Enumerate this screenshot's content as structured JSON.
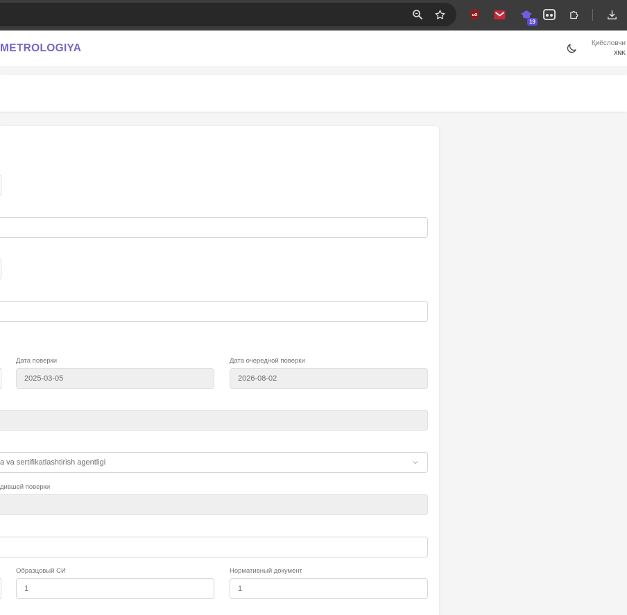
{
  "browser": {
    "icons": [
      "zoom-icon",
      "bookmark-star-icon",
      "ublock-extension-icon",
      "mail-extension-icon",
      "extension-badge-icon",
      "reader-extension-icon",
      "extensions-puzzle-icon",
      "download-icon"
    ],
    "extension_badge_count": "19"
  },
  "header": {
    "brand": "METROLOGIYA",
    "user_role": "Қиёсловчи",
    "user_org": "XNK"
  },
  "form": {
    "verification_date_label": "Дата поверки",
    "verification_date_value": "2025-03-05",
    "next_verification_date_label": "Дата очередной поверки",
    "next_verification_date_value": "2026-08-02",
    "agency_value": "a va sertifikatlashtirish agentligi",
    "passed_verification_label": "дившей поверки",
    "reference_si_label": "Образцовый СИ",
    "reference_si_value": "1",
    "normative_doc_label": "Нормативный документ",
    "normative_doc_value": "1"
  }
}
